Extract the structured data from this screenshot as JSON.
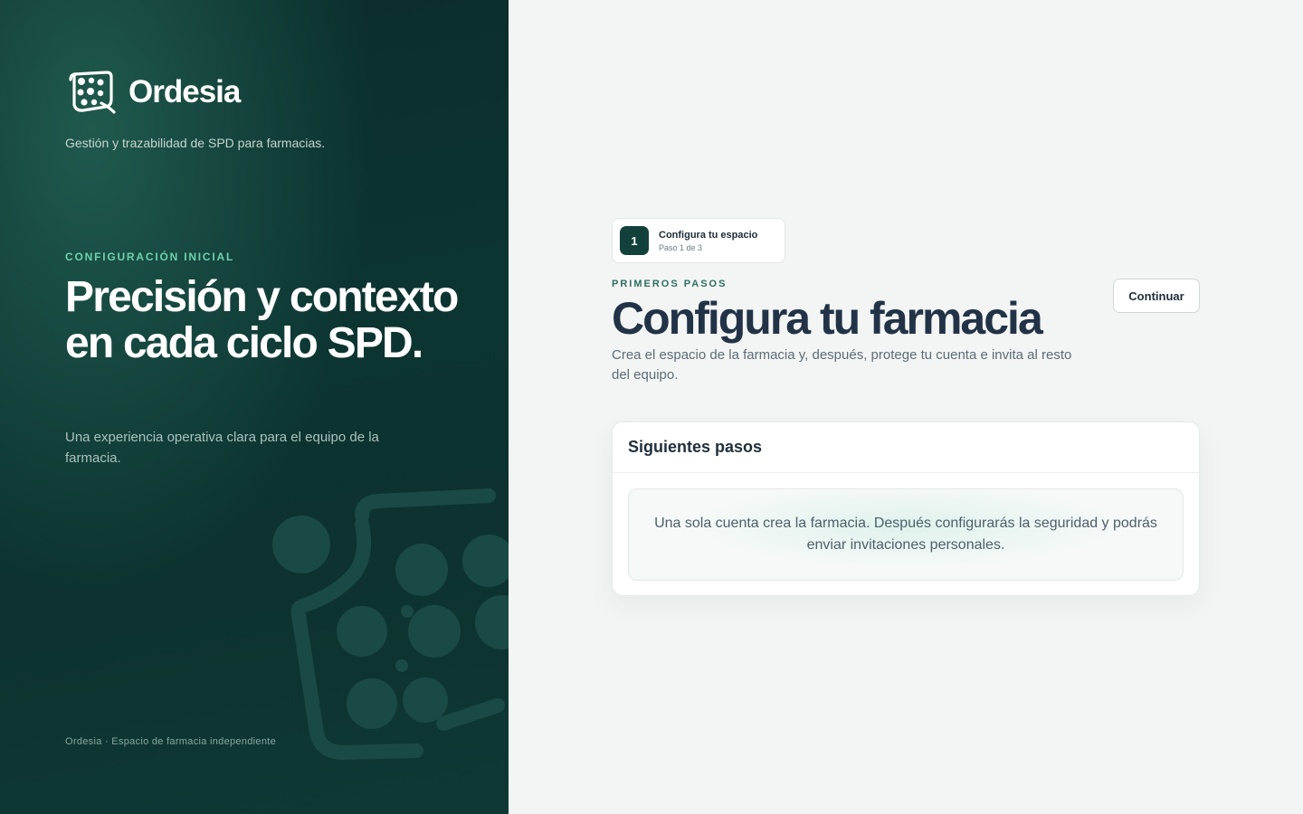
{
  "brand": {
    "name": "Ordesia",
    "tagline": "Gestión y trazabilidad de SPD para farmacias."
  },
  "hero": {
    "eyebrow": "CONFIGURACIÓN INICIAL",
    "title": "Precisión y contexto en cada ciclo SPD.",
    "subtitle": "Una experiencia operativa clara para el equipo de la farmacia."
  },
  "footer": {
    "text": "Ordesia · Espacio de farmacia independiente"
  },
  "stepper": {
    "number": "1",
    "title": "Configura tu espacio",
    "subtitle": "Paso 1 de 3"
  },
  "main": {
    "eyebrow": "PRIMEROS PASOS",
    "title": "Configura tu farmacia",
    "subtitle": "Crea el espacio de la farmacia y, después, protege tu cuenta e invita al resto del equipo.",
    "continue_label": "Continuar"
  },
  "card": {
    "title": "Siguientes pasos",
    "info": "Una sola cuenta crea la farmacia. Después configurarás la seguridad y podrás enviar invitaciones personales."
  },
  "colors": {
    "panel_dark": "#0c3431",
    "accent_green": "#6fd1ad",
    "title_navy": "#223347",
    "step_badge": "#12413b"
  }
}
